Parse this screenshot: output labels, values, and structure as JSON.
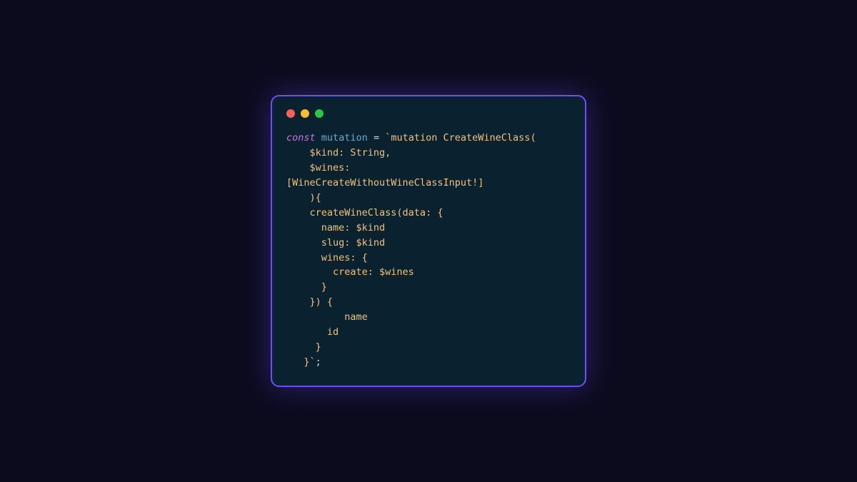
{
  "colors": {
    "bg": "#0c0b1e",
    "window_bg": "#0a2230",
    "border": "#6b4eff",
    "keyword": "#c678dd",
    "identifier": "#6fa6d6",
    "operator": "#d7d2c8",
    "string": "#f3c27b",
    "traffic_red": "#ff5f57",
    "traffic_yellow": "#febc2e",
    "traffic_green": "#28c840"
  },
  "code": {
    "keyword": "const",
    "identifier": "mutation",
    "operator": "=",
    "string_open": "`",
    "line1_tail": "mutation CreateWineClass(",
    "line2": "    $kind: String,",
    "line3": "    $wines:",
    "line4": "[WineCreateWithoutWineClassInput!]",
    "line5": "    ){",
    "line6": "    createWineClass(data: {",
    "line7": "      name: $kind",
    "line8": "      slug: $kind",
    "line9": "      wines: {",
    "line10": "        create: $wines",
    "line11": "      }",
    "line12": "    }) {",
    "line13": "          name",
    "line14": "       id",
    "line15": "     }",
    "line16_head": "   }",
    "string_close": "`",
    "terminator": ";"
  }
}
